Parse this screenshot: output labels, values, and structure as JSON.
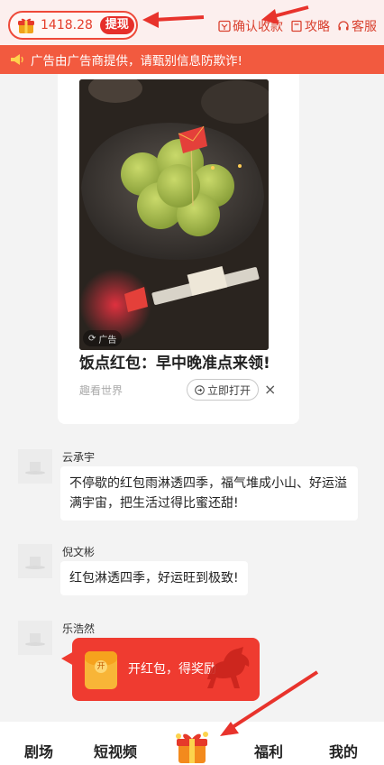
{
  "header": {
    "balance": "1418.28",
    "withdraw_label": "提现",
    "links": [
      {
        "label": "确认收款",
        "icon": "receipt-icon"
      },
      {
        "label": "攻略",
        "icon": "book-icon"
      },
      {
        "label": "客服",
        "icon": "headset-icon"
      }
    ]
  },
  "notice": {
    "text": "广告由广告商提供，请甄别信息防欺诈!",
    "icon": "megaphone-icon"
  },
  "ad": {
    "badge": "广告",
    "title": "饭点红包：早中晚准点来领!",
    "source": "趣看世界",
    "open_label": "立即打开",
    "close_label": "×"
  },
  "comments": [
    {
      "name": "云承宇",
      "text": "不停歇的红包雨淋透四季，福气堆成小山、好运溢满宇宙，把生活过得比蜜还甜!"
    },
    {
      "name": "倪文彬",
      "text": "红包淋透四季，好运旺到极致!"
    },
    {
      "name": "乐浩然",
      "text": ""
    }
  ],
  "popup": {
    "coin_label": "开",
    "text": "开红包，得奖励"
  },
  "bottom_nav": [
    {
      "label": "剧场"
    },
    {
      "label": "短视频"
    },
    {
      "label": "福利"
    },
    {
      "label": "我的"
    }
  ],
  "colors": {
    "accent_red": "#e62f2a",
    "notice_bg": "#f25a3f",
    "topbar_bg": "#fcefee",
    "popup_bg": "#ef3b30",
    "arrow_red": "#e8332c"
  }
}
